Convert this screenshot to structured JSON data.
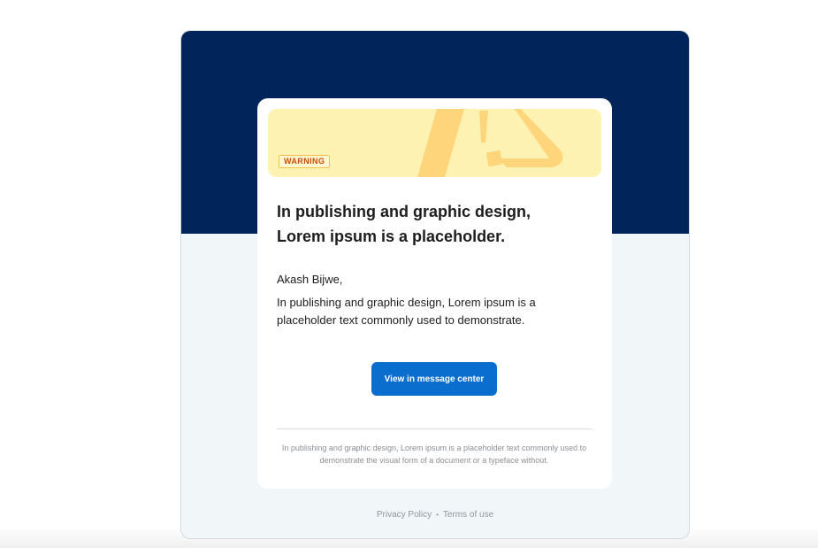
{
  "colors": {
    "header_navy": "#01245a",
    "page_bg": "#f1f7f9",
    "warning_banner": "#fef2b3",
    "warning_icon": "#fed57b",
    "badge_text": "#c84b07",
    "cta_blue": "#0a6ecf"
  },
  "banner": {
    "icon": "warning-triangle-icon",
    "badge": "WARNING"
  },
  "message": {
    "title": "In publishing and graphic design, Lorem ipsum is a placeholder.",
    "greeting": "Akash Bijwe,",
    "body": "In publishing and graphic design, Lorem ipsum is a placeholder text commonly used to demonstrate.",
    "cta_label": "View in message center",
    "footnote": "In publishing and graphic design, Lorem ipsum is a placeholder text commonly used to demonstrate the visual form of a document or a typeface without."
  },
  "footer": {
    "privacy_label": "Privacy Policy",
    "separator": "•",
    "terms_label": "Terms of use"
  }
}
